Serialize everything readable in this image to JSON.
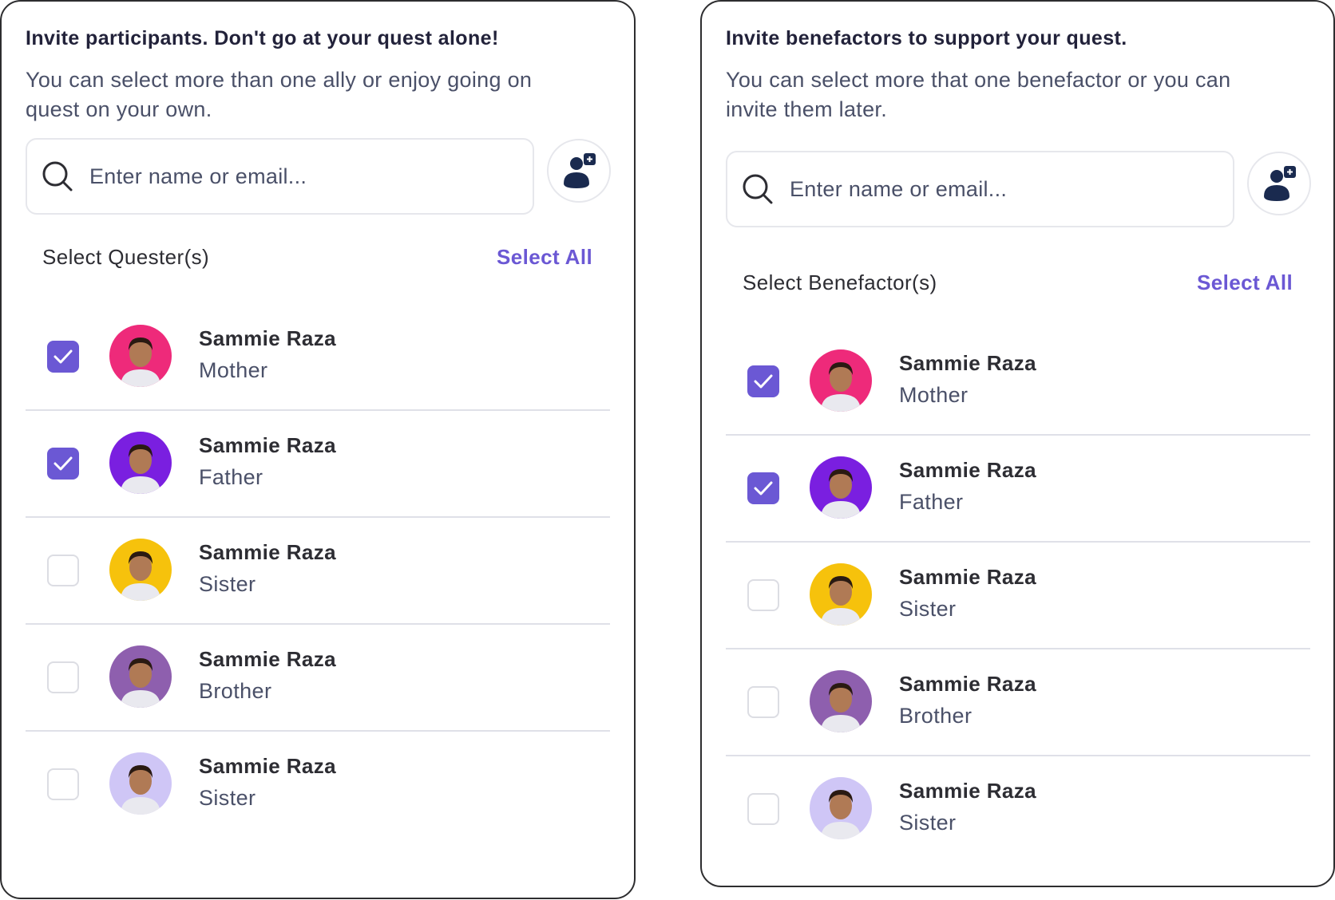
{
  "left_panel": {
    "title": "Invite participants. Don't go at your quest alone!",
    "subtitle": "You can select more than one ally or enjoy going on quest on your own.",
    "search_placeholder": "Enter name or email...",
    "section_label": "Select Quester(s)",
    "select_all_label": "Select All",
    "members": [
      {
        "name": "Sammie Raza",
        "role": "Mother",
        "checked": true,
        "avatar_bg": "#ee2a7a"
      },
      {
        "name": "Sammie Raza",
        "role": "Father",
        "checked": true,
        "avatar_bg": "#7a1fe0"
      },
      {
        "name": "Sammie Raza",
        "role": "Sister",
        "checked": false,
        "avatar_bg": "#f6c20c"
      },
      {
        "name": "Sammie Raza",
        "role": "Brother",
        "checked": false,
        "avatar_bg": "#8e5fae"
      },
      {
        "name": "Sammie Raza",
        "role": "Sister",
        "checked": false,
        "avatar_bg": "#cfc6f6"
      }
    ]
  },
  "right_panel": {
    "title": "Invite benefactors to support your quest.",
    "subtitle": "You can select more that one benefactor or you can invite them later.",
    "search_placeholder": "Enter name or email...",
    "section_label": "Select Benefactor(s)",
    "select_all_label": "Select All",
    "members": [
      {
        "name": "Sammie Raza",
        "role": "Mother",
        "checked": true,
        "avatar_bg": "#ee2a7a"
      },
      {
        "name": "Sammie Raza",
        "role": "Father",
        "checked": true,
        "avatar_bg": "#7a1fe0"
      },
      {
        "name": "Sammie Raza",
        "role": "Sister",
        "checked": false,
        "avatar_bg": "#f6c20c"
      },
      {
        "name": "Sammie Raza",
        "role": "Brother",
        "checked": false,
        "avatar_bg": "#8e5fae"
      },
      {
        "name": "Sammie Raza",
        "role": "Sister",
        "checked": false,
        "avatar_bg": "#cfc6f6"
      }
    ]
  },
  "icons": {
    "search": "search-icon",
    "add_user": "add-user-icon",
    "check": "checkmark-icon"
  },
  "colors": {
    "accent": "#6b58d4",
    "text_dark": "#2d2d33",
    "text_muted": "#4a5068",
    "divider": "#dfe0e8",
    "add_user_icon": "#1a2a4f"
  }
}
